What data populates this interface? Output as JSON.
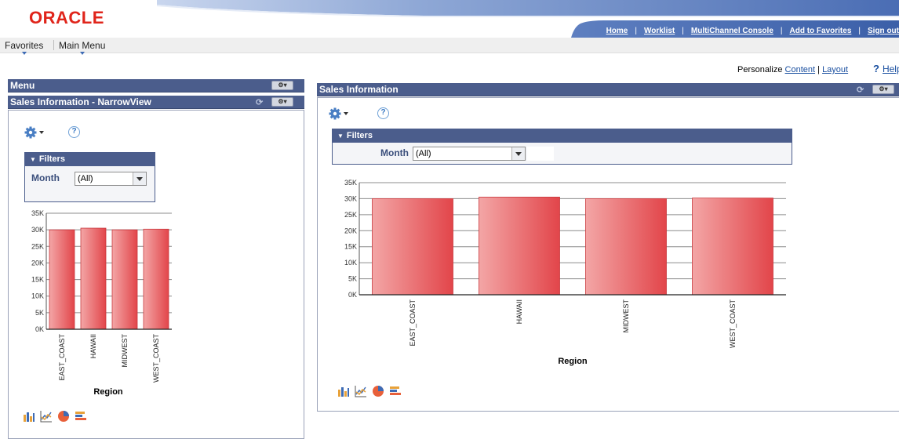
{
  "brand": {
    "logo": "ORACLE"
  },
  "header": {
    "links": [
      "Home",
      "Worklist",
      "MultiChannel Console",
      "Add to Favorites",
      "Sign out"
    ],
    "separator": "|"
  },
  "nav": {
    "favorites": "Favorites",
    "main_menu": "Main Menu"
  },
  "personalize": {
    "label": "Personalize",
    "content": "Content",
    "sep": "|",
    "layout": "Layout",
    "help": "Help",
    "help_symbol": "?"
  },
  "menu_pagelet": {
    "title": "Menu"
  },
  "narrow": {
    "title": "Sales Information - NarrowView",
    "filters_label": "Filters",
    "month_label": "Month",
    "month_value": "(All)"
  },
  "wide": {
    "title": "Sales Information",
    "filters_label": "Filters",
    "month_label": "Month",
    "month_value": "(All)"
  },
  "icons": {
    "gear": "gear-icon",
    "help": "help-icon",
    "refresh": "refresh-icon",
    "chart_types": [
      "bar-chart-icon",
      "line-chart-icon",
      "pie-chart-icon",
      "horizontal-bar-chart-icon"
    ]
  },
  "colors": {
    "header_bar": "#4b5d8c",
    "bar_light": "#f3a6a6",
    "bar_dark": "#e2454a",
    "logo": "#e0251b"
  },
  "chart_data": [
    {
      "type": "bar",
      "categories": [
        "EAST_COAST",
        "HAWAII",
        "MIDWEST",
        "WEST_COAST"
      ],
      "values": [
        30000,
        30500,
        30000,
        30200
      ],
      "xlabel": "Region",
      "ylabel": "",
      "ylim": [
        0,
        35000
      ],
      "yticks": [
        "0K",
        "5K",
        "10K",
        "15K",
        "20K",
        "25K",
        "30K",
        "35K"
      ],
      "grid": true,
      "legend": "none"
    },
    {
      "type": "bar",
      "categories": [
        "EAST_COAST",
        "HAWAII",
        "MIDWEST",
        "WEST_COAST"
      ],
      "values": [
        30000,
        30500,
        30000,
        30200
      ],
      "xlabel": "Region",
      "ylabel": "",
      "ylim": [
        0,
        35000
      ],
      "yticks": [
        "0K",
        "5K",
        "10K",
        "15K",
        "20K",
        "25K",
        "30K",
        "35K"
      ],
      "grid": true,
      "legend": "none"
    }
  ]
}
